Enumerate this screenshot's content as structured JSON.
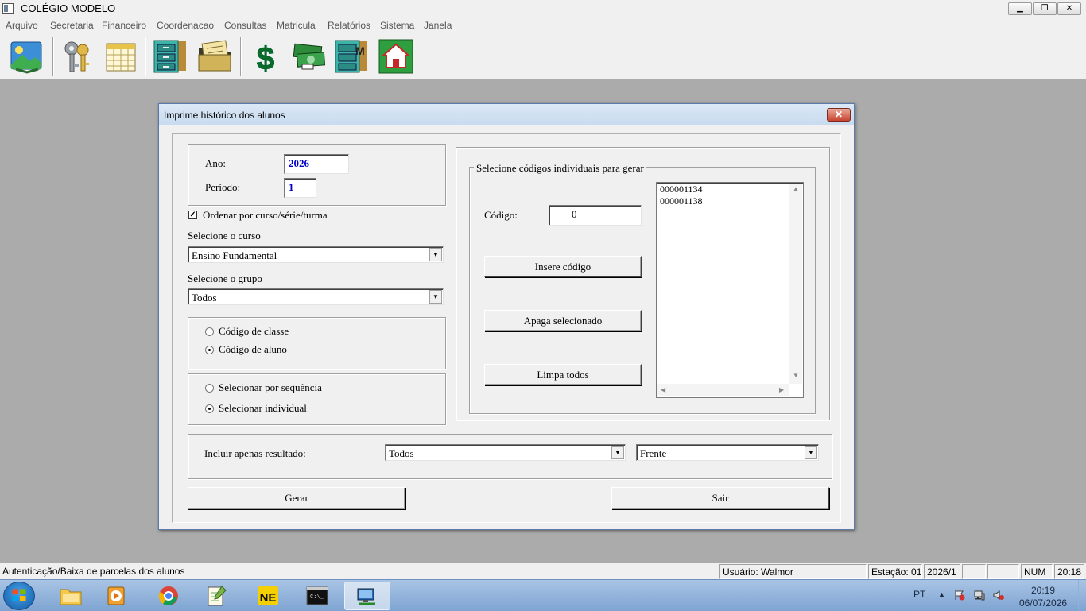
{
  "app": {
    "title": "COLÉGIO MODELO",
    "window_controls": {
      "minimize": "▁",
      "maximize": "❐",
      "close": "✕"
    }
  },
  "menu": [
    "Arquivo",
    "Secretaria",
    "Financeiro",
    "Coordenacao",
    "Consultas",
    "Matricula",
    "Relatórios",
    "Sistema",
    "Janela"
  ],
  "toolbar": {
    "buttons": [
      "image-landscape-icon",
      "keys-icon",
      "calendar-icon",
      "filing-cabinet-icon",
      "documents-folder-icon",
      "dollar-icon",
      "money-bills-icon",
      "filing-cabinet-m-icon",
      "home-icon"
    ]
  },
  "dialog": {
    "title": "Imprime histórico dos alunos",
    "close_label": "✕",
    "ano_label": "Ano:",
    "ano_value": "2026",
    "periodo_label": "Período:",
    "periodo_value": "1",
    "ordenar_checked": true,
    "ordenar_label": "Ordenar por curso/série/turma",
    "curso_label": "Selecione o curso",
    "curso_value": "Ensino Fundamental",
    "grupo_label": "Selecione o grupo",
    "grupo_value": "Todos",
    "codigo_tipo": {
      "classe_label": "Código de classe",
      "aluno_label": "Código de aluno",
      "selected": "aluno"
    },
    "selecao": {
      "sequencia_label": "Selecionar por sequência",
      "individual_label": "Selecionar individual",
      "selected": "individual"
    },
    "individual_group_title": "Selecione códigos individuais para gerar",
    "codigo_label": "Código:",
    "codigo_value": "0",
    "insere_button": "Insere código",
    "apaga_button": "Apaga selecionado",
    "limpa_button": "Limpa todos",
    "codes": [
      "000001134",
      "000001138"
    ],
    "resultado_label": "Incluir apenas resultado:",
    "resultado_value": "Todos",
    "lado_value": "Frente",
    "gerar_button": "Gerar",
    "sair_button": "Sair"
  },
  "statusbar": {
    "message": "Autenticação/Baixa de parcelas dos alunos",
    "usuario": "Usuário: Walmor",
    "estacao": "Estação: 01",
    "periodo": "2026/1",
    "num": "NUM",
    "time": "20:18"
  },
  "taskbar": {
    "apps": [
      "explorer-folder-icon",
      "media-player-icon",
      "chrome-icon",
      "notepad-plus-icon",
      "ne-app-icon",
      "command-prompt-icon",
      "network-app-icon"
    ],
    "active_app": "network-app-icon",
    "language": "PT",
    "clock_time": "20:19",
    "clock_date": "06/07/2026"
  },
  "colors": {
    "mdi_background": "#ababab",
    "dialog_title_gradient": "#c8dbef",
    "field_value_blue": "#0000c8",
    "close_button_red": "#c94330"
  }
}
